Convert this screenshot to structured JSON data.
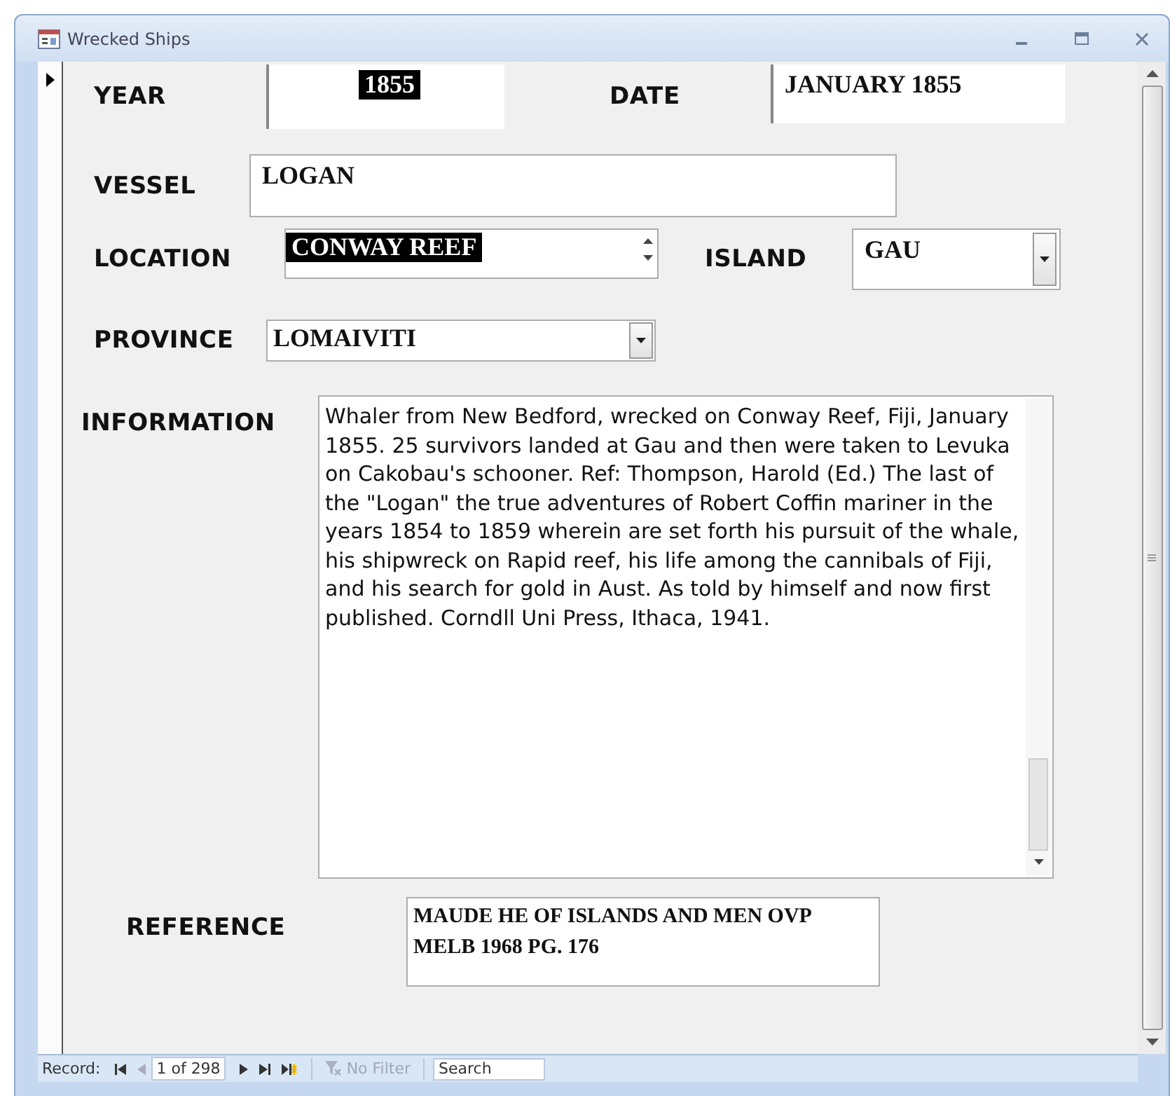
{
  "window": {
    "title": "Wrecked Ships"
  },
  "rows": [
    [
      {
        "label": "YEAR",
        "value": "1855",
        "kind": "text",
        "selected": true
      },
      {
        "label": "DATE",
        "value": "JANUARY 1855",
        "kind": "text",
        "selected": false
      }
    ],
    [
      {
        "label": "VESSEL",
        "value": "LOGAN",
        "kind": "text",
        "selected": false
      }
    ],
    [
      {
        "label": "LOCATION",
        "value": "CONWAY REEF",
        "kind": "spin",
        "selected": true
      },
      {
        "label": "ISLAND",
        "value": "GAU",
        "kind": "combo",
        "selected": false
      }
    ],
    [
      {
        "label": "PROVINCE",
        "value": "LOMAIVITI",
        "kind": "combo",
        "selected": false
      }
    ],
    [
      {
        "label": "INFORMATION",
        "value": "Whaler from New Bedford, wrecked on Conway Reef, Fiji, January 1855. 25 survivors landed at Gau and then were taken to Levuka on Cakobau's schooner. Ref: Thompson, Harold (Ed.) The last of the \"Logan\" the true adventures of Robert Coffin mariner in the years 1854 to 1859 wherein are set forth his pursuit of the whale, his shipwreck on Rapid reef, his life among the cannibals of Fiji, and his search for gold in Aust. As told by himself and now first published. Corndll Uni Press, Ithaca, 1941.",
        "kind": "memo",
        "selected": false
      }
    ],
    [
      {
        "label": "REFERENCE",
        "value": "MAUDE HE OF ISLANDS AND MEN OVP MELB 1968 PG. 176",
        "kind": "text",
        "selected": false
      }
    ]
  ],
  "status_bar": {
    "label": "Record:",
    "position": "1 of 298",
    "filter": {
      "label": "No Filter",
      "disabled": true
    },
    "search": {
      "placeholder": "Search"
    }
  }
}
